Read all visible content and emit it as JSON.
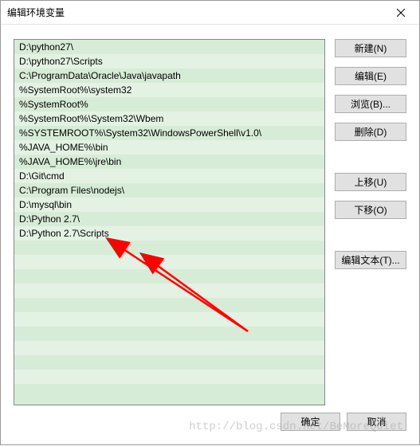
{
  "window": {
    "title": "编辑环境变量"
  },
  "paths": [
    "D:\\python27\\",
    "D:\\python27\\Scripts",
    "C:\\ProgramData\\Oracle\\Java\\javapath",
    "%SystemRoot%\\system32",
    "%SystemRoot%",
    "%SystemRoot%\\System32\\Wbem",
    "%SYSTEMROOT%\\System32\\WindowsPowerShell\\v1.0\\",
    "%JAVA_HOME%\\bin",
    "%JAVA_HOME%\\jre\\bin",
    "D:\\Git\\cmd",
    "C:\\Program Files\\nodejs\\",
    "D:\\mysql\\bin",
    "D:\\Python 2.7\\",
    "D:\\Python 2.7\\Scripts"
  ],
  "buttons": {
    "new": "新建(N)",
    "edit": "编辑(E)",
    "browse": "浏览(B)...",
    "delete": "删除(D)",
    "up": "上移(U)",
    "down": "下移(O)",
    "edit_text": "编辑文本(T)...",
    "ok": "确定",
    "cancel": "取消"
  },
  "watermark": "http://blog.csdn.net/BeMoreQuiet"
}
